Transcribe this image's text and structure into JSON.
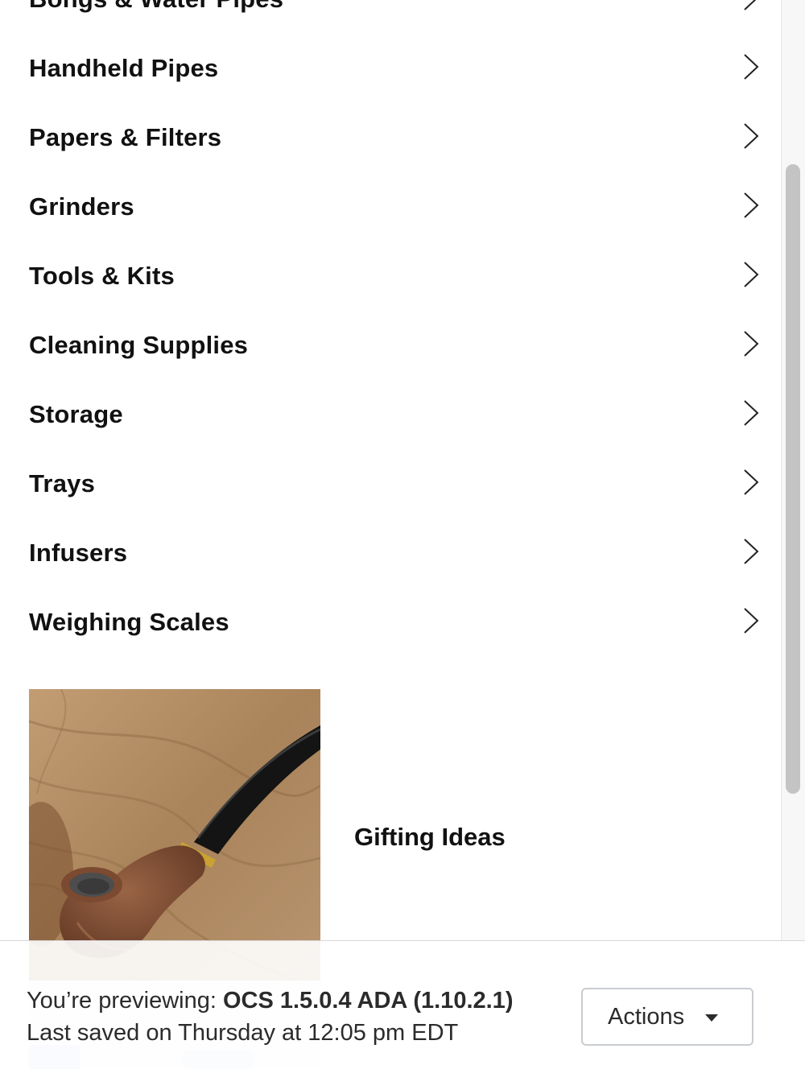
{
  "categories": [
    {
      "label": "Bongs & Water Pipes"
    },
    {
      "label": "Handheld Pipes"
    },
    {
      "label": "Papers & Filters"
    },
    {
      "label": "Grinders"
    },
    {
      "label": "Tools & Kits"
    },
    {
      "label": "Cleaning Supplies"
    },
    {
      "label": "Storage"
    },
    {
      "label": "Trays"
    },
    {
      "label": "Infusers"
    },
    {
      "label": "Weighing Scales"
    }
  ],
  "feature": {
    "label": "Gifting Ideas",
    "image_icon": "pipe-photo"
  },
  "preview_bar": {
    "prefix": "You’re previewing: ",
    "theme_name": "OCS 1.5.0.4 ADA (1.10.2.1)",
    "last_saved": "Last saved on Thursday at 12:05 pm EDT",
    "actions_label": "Actions"
  },
  "colors": {
    "text": "#111111",
    "scrollbar_thumb": "#c4c4c4",
    "button_border": "#c9cdd1"
  }
}
